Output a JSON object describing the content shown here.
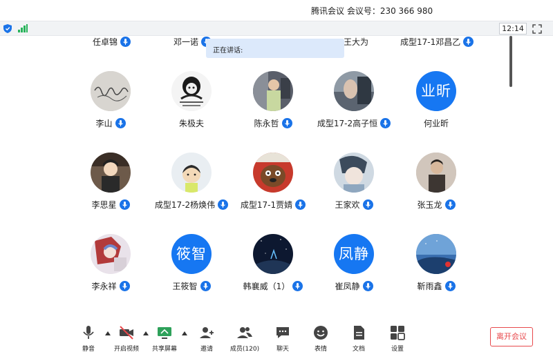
{
  "app": {
    "title": "腾讯会议 会议号：230 366 980",
    "clock": "12:14",
    "speaking_label": "正在讲话:"
  },
  "colors": {
    "accent": "#1677f2",
    "mic_badge": "#1a73e8",
    "leave_red": "#e8484b",
    "signal_green": "#27b35a"
  },
  "top_row": [
    {
      "name": "任卓锦"
    },
    {
      "name": "邓一诺"
    },
    {
      "name": "王大为"
    },
    {
      "name": "成型17-1邓昌乙"
    }
  ],
  "participants": [
    {
      "name": "李山",
      "avatar_type": "photo",
      "avatar_desc": "handwriting-photo"
    },
    {
      "name": "朱极夫",
      "avatar_type": "photo",
      "avatar_desc": "meme-photo"
    },
    {
      "name": "陈永哲",
      "avatar_type": "photo",
      "avatar_desc": "person-photo"
    },
    {
      "name": "成型17-2高子恒",
      "avatar_type": "photo",
      "avatar_desc": "hand-photo"
    },
    {
      "name": "何业昕",
      "avatar_type": "initials",
      "initials": "业昕"
    },
    {
      "name": "李思星",
      "avatar_type": "photo",
      "avatar_desc": "anime-photo"
    },
    {
      "name": "成型17-2杨焕伟",
      "avatar_type": "photo",
      "avatar_desc": "cartoon-photo"
    },
    {
      "name": "成型17-1贾婧",
      "avatar_type": "photo",
      "avatar_desc": "cartoon-dog-photo"
    },
    {
      "name": "王家欢",
      "avatar_type": "photo",
      "avatar_desc": "anime-boy-photo"
    },
    {
      "name": "张玉龙",
      "avatar_type": "photo",
      "avatar_desc": "person-photo"
    },
    {
      "name": "李永祥",
      "avatar_type": "photo",
      "avatar_desc": "anime-girl-photo"
    },
    {
      "name": "王筱智",
      "avatar_type": "initials",
      "initials": "筱智"
    },
    {
      "name": "韩襄威（1）",
      "avatar_type": "photo",
      "avatar_desc": "night-sky-photo"
    },
    {
      "name": "崔凤静",
      "avatar_type": "initials",
      "initials": "凤静"
    },
    {
      "name": "靳雨鑫",
      "avatar_type": "photo",
      "avatar_desc": "sky-photo"
    }
  ],
  "toolbar": {
    "mute": "静音",
    "video": "开启视频",
    "share": "共享屏幕",
    "invite": "邀请",
    "members": "成员(120)",
    "chat": "聊天",
    "emoji": "表情",
    "docs": "文档",
    "settings": "设置",
    "leave": "离开会议"
  }
}
